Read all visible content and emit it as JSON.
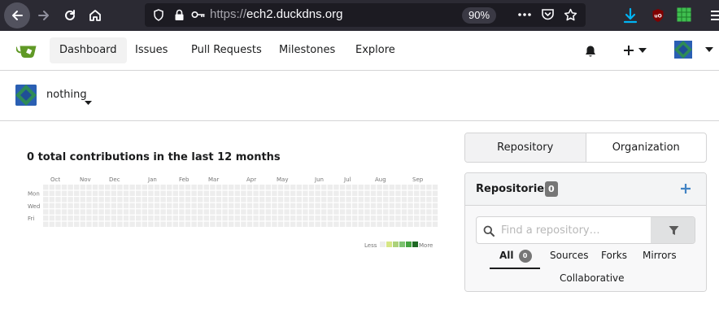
{
  "browser": {
    "url_protocol": "https://",
    "url_host": "ech2.duckdns.org",
    "zoom": "90%",
    "back_icon": "arrow-left-icon",
    "forward_icon": "arrow-right-icon",
    "reload_icon": "reload-icon",
    "home_icon": "home-icon"
  },
  "header": {
    "nav": [
      {
        "label": "Dashboard",
        "active": true
      },
      {
        "label": "Issues"
      },
      {
        "label": "Pull Requests"
      },
      {
        "label": "Milestones"
      },
      {
        "label": "Explore"
      }
    ],
    "accent": "#609926"
  },
  "context": {
    "name": "nothing"
  },
  "heatmap": {
    "title": "0 total contributions in the last 12 months",
    "months": [
      "Oct",
      "Nov",
      "Dec",
      "Jan",
      "Feb",
      "Mar",
      "Apr",
      "May",
      "Jun",
      "Jul",
      "Aug",
      "Sep"
    ],
    "days": [
      "Mon",
      "Wed",
      "Fri"
    ],
    "legend_less": "Less",
    "legend_more": "More",
    "empty_color": "#ededed",
    "scale_colors": [
      "#ededed",
      "#d6e685",
      "#acd27a",
      "#7cc26f",
      "#44a340",
      "#1e6823"
    ]
  },
  "switch": {
    "repository": "Repository",
    "organization": "Organization"
  },
  "repos": {
    "title": "Repositories",
    "count": "0",
    "search_placeholder": "Find a repository…",
    "tabs": {
      "all": "All",
      "all_count": "0",
      "sources": "Sources",
      "forks": "Forks",
      "mirrors": "Mirrors",
      "collaborative": "Collaborative"
    }
  }
}
